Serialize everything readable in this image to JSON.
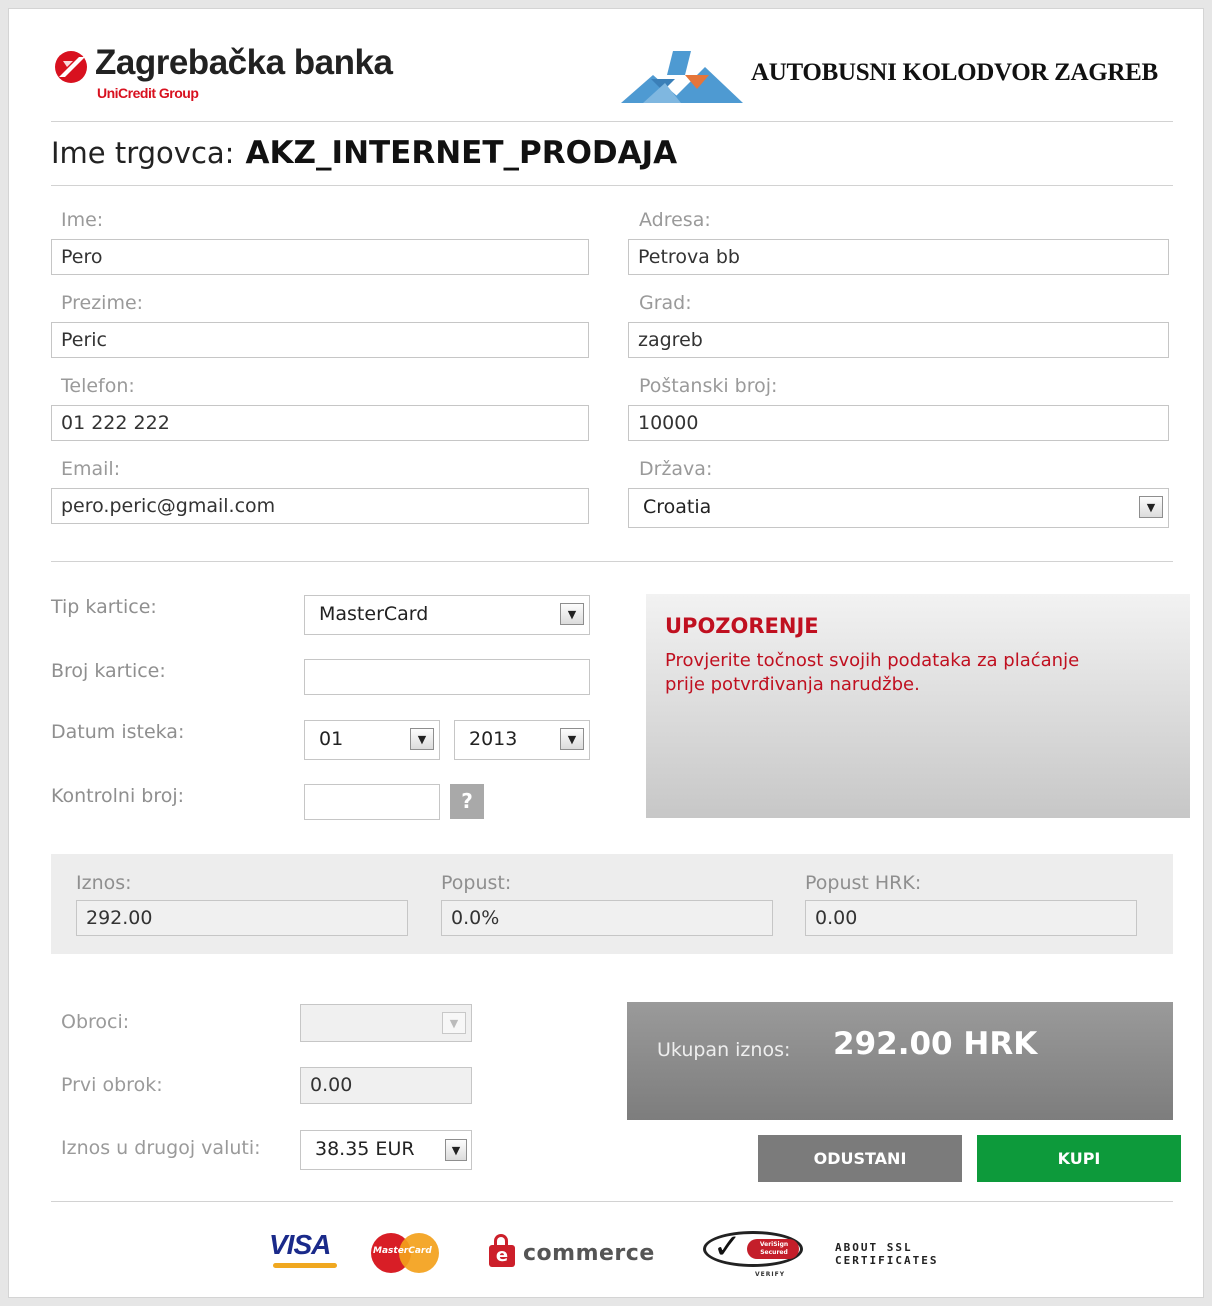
{
  "header": {
    "bank_name": "Zagrebačka banka",
    "bank_group": "UniCredit Group",
    "partner_name": "AUTOBUSNI KOLODVOR ZAGREB"
  },
  "merchant": {
    "label": "Ime trgovca:",
    "value": "AKZ_INTERNET_PRODAJA"
  },
  "customer": {
    "ime": {
      "label": "Ime:",
      "value": "Pero"
    },
    "prezime": {
      "label": "Prezime:",
      "value": "Peric"
    },
    "telefon": {
      "label": "Telefon:",
      "value": "01 222 222"
    },
    "email": {
      "label": "Email:",
      "value": "pero.peric@gmail.com"
    },
    "adresa": {
      "label": "Adresa:",
      "value": "Petrova bb"
    },
    "grad": {
      "label": "Grad:",
      "value": "zagreb"
    },
    "postanski": {
      "label": "Poštanski broj:",
      "value": "10000"
    },
    "drzava": {
      "label": "Država:",
      "value": "Croatia"
    }
  },
  "card": {
    "tip": {
      "label": "Tip kartice:",
      "value": "MasterCard"
    },
    "broj": {
      "label": "Broj kartice:",
      "value": ""
    },
    "datum": {
      "label": "Datum isteka:",
      "month": "01",
      "year": "2013"
    },
    "kontrolni": {
      "label": "Kontrolni broj:",
      "value": "",
      "help": "?"
    }
  },
  "warning": {
    "title": "UPOZORENJE",
    "text_line1": "Provjerite točnost svojih podataka za plaćanje",
    "text_line2": "prije potvrđivanja narudžbe."
  },
  "amounts": {
    "iznos": {
      "label": "Iznos:",
      "value": "292.00"
    },
    "popust": {
      "label": "Popust:",
      "value": "0.0%"
    },
    "popust_hrk": {
      "label": "Popust HRK:",
      "value": "0.00"
    }
  },
  "installments": {
    "obroci": {
      "label": "Obroci:",
      "value": ""
    },
    "prvi": {
      "label": "Prvi obrok:",
      "value": "0.00"
    },
    "drugoj": {
      "label": "Iznos u drugoj valuti:",
      "value": "38.35 EUR"
    }
  },
  "total": {
    "label": "Ukupan iznos:",
    "value": "292.00 HRK"
  },
  "buttons": {
    "cancel": "ODUSTANI",
    "buy": "KUPI"
  },
  "footer": {
    "visa": "VISA",
    "mastercard": "MasterCard",
    "ecommerce": "commerce",
    "verisign": "VeriSign Secured",
    "verisign_sub": "VERIFY",
    "ssl_line1": "ABOUT SSL",
    "ssl_line2": "CERTIFICATES"
  },
  "colors": {
    "warning_red": "#c01020",
    "buy_green": "#0d9a3b",
    "cancel_grey": "#7b7b7b"
  }
}
